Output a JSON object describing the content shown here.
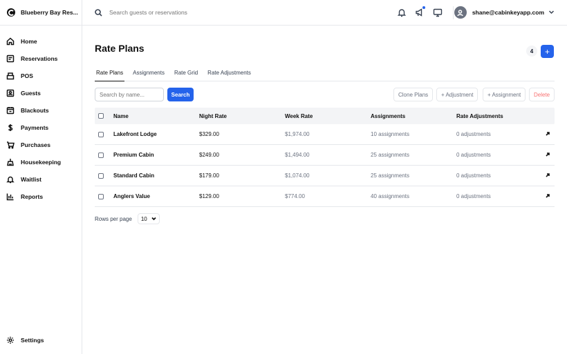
{
  "brand": {
    "name": "Blueberry Bay Res..."
  },
  "sidebar": {
    "items": [
      {
        "label": "Home",
        "icon": "home-icon"
      },
      {
        "label": "Reservations",
        "icon": "calendar-edit-icon"
      },
      {
        "label": "POS",
        "icon": "register-icon"
      },
      {
        "label": "Guests",
        "icon": "id-card-icon"
      },
      {
        "label": "Blackouts",
        "icon": "calendar-block-icon"
      },
      {
        "label": "Payments",
        "icon": "dollar-icon"
      },
      {
        "label": "Purchases",
        "icon": "cart-icon"
      },
      {
        "label": "Housekeeping",
        "icon": "cleaning-icon"
      },
      {
        "label": "Waitlist",
        "icon": "bell-icon"
      },
      {
        "label": "Reports",
        "icon": "bar-chart-icon"
      }
    ],
    "settings_label": "Settings"
  },
  "topbar": {
    "search_placeholder": "Search guests or reservations",
    "user_email": "shane@cabinkeyapp.com"
  },
  "page": {
    "title": "Rate Plans",
    "count": "4",
    "add_label": "+"
  },
  "tabs": [
    "Rate Plans",
    "Assignments",
    "Rate Grid",
    "Rate Adjustments"
  ],
  "toolbar": {
    "search_placeholder": "Search by name...",
    "search_label": "Search",
    "clone_label": "Clone Plans",
    "adjustment_label": "+ Adjustment",
    "assignment_label": "+ Assignment",
    "delete_label": "Delete"
  },
  "table": {
    "headers": {
      "name": "Name",
      "night": "Night Rate",
      "week": "Week Rate",
      "assign": "Assignments",
      "adj": "Rate Adjustments"
    },
    "rows": [
      {
        "name": "Lakefront Lodge",
        "night": "$329.00",
        "week": "$1,974.00",
        "assign": "10 assignments",
        "adj": "0 adjustments"
      },
      {
        "name": "Premium Cabin",
        "night": "$249.00",
        "week": "$1,494.00",
        "assign": "25 assignments",
        "adj": "0 adjustments"
      },
      {
        "name": "Standard Cabin",
        "night": "$179.00",
        "week": "$1,074.00",
        "assign": "25 assignments",
        "adj": "0 adjustments"
      },
      {
        "name": "Anglers Value",
        "night": "$129.00",
        "week": "$774.00",
        "assign": "40 assignments",
        "adj": "0 adjustments"
      }
    ]
  },
  "pager": {
    "label": "Rows per page",
    "value": "10"
  },
  "colors": {
    "accent": "#2563eb",
    "danger": "#f87171"
  }
}
